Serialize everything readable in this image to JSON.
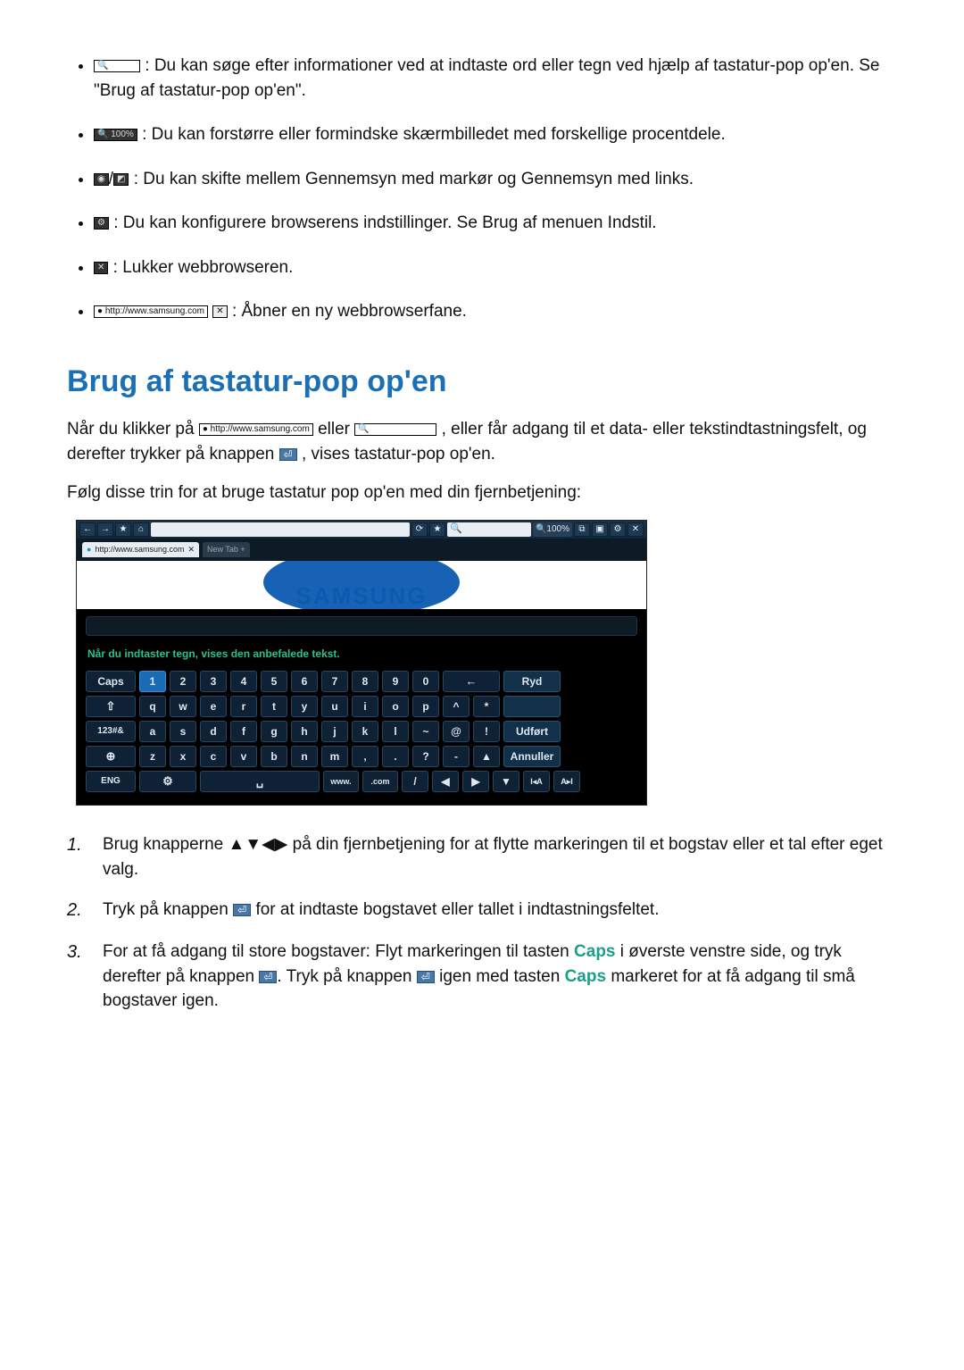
{
  "bullets": {
    "search": ": Du kan søge efter informationer ved at indtaste ord eller tegn ved hjælp af tastatur-pop op'en. Se \"Brug af tastatur-pop op'en\".",
    "zoom": ": Du kan forstørre eller formindske skærmbilledet med forskellige procentdele.",
    "cursor": ": Du kan skifte mellem Gennemsyn med markør og Gennemsyn med links.",
    "settings": ": Du kan konfigurere browserens indstillinger. Se Brug af menuen Indstil.",
    "close": ": Lukker webbrowseren.",
    "newtab": ": Åbner en ny webbrowserfane."
  },
  "zoom_chip": "100%",
  "url_chip": "http://www.samsung.com",
  "heading": "Brug af tastatur-pop op'en",
  "intro": {
    "pre": "Når du klikker på ",
    "mid": " eller ",
    "post": ", eller får adgang til et data- eller tekstindtastningsfelt, og derefter trykker på knappen ",
    "tail": ", vises tastatur-pop op'en."
  },
  "follow": "Følg disse trin for at bruge tastatur pop op'en med din fjernbetjening:",
  "mock": {
    "toolbar_zoom": "100%",
    "tab_url": "http://www.samsung.com",
    "tab_new": "New Tab +",
    "brand": "SAMSUNG",
    "hint": "Når du indtaster tegn, vises den anbefalede tekst.",
    "rows": {
      "r1_left": "Caps",
      "r1": [
        "1",
        "2",
        "3",
        "4",
        "5",
        "6",
        "7",
        "8",
        "9",
        "0"
      ],
      "r1_bksp": "←",
      "r1_action": "Ryd",
      "r2_left": "⇧",
      "r2": [
        "q",
        "w",
        "e",
        "r",
        "t",
        "y",
        "u",
        "i",
        "o",
        "p",
        "^",
        "*"
      ],
      "r3_left": "123#&",
      "r3": [
        "a",
        "s",
        "d",
        "f",
        "g",
        "h",
        "j",
        "k",
        "l",
        "~",
        "@",
        "!"
      ],
      "r3_action": "Udført",
      "r4_left": "⊕",
      "r4": [
        "z",
        "x",
        "c",
        "v",
        "b",
        "n",
        "m",
        ",",
        ".",
        "?",
        "-",
        "▲"
      ],
      "r4_action": "Annuller",
      "r5_left": "ENG",
      "r5_gear": "⚙",
      "r5_space": "␣",
      "r5_www": "www.",
      "r5_com": ".com",
      "r5_slash": "/",
      "r5_left_arrow": "◀",
      "r5_right_arrow": "▶",
      "r5_down": "▼",
      "r5_a1": "I◂A",
      "r5_a2": "A▸I"
    }
  },
  "steps": {
    "s1": {
      "pre": "Brug knapperne ",
      "arrows": "▲▼◀▶",
      "post": " på din fjernbetjening for at flytte markeringen til et bogstav eller et tal efter eget valg."
    },
    "s2": {
      "pre": "Tryk på knappen ",
      "post": " for at indtaste bogstavet eller tallet i indtastningsfeltet."
    },
    "s3": {
      "a": "For at få adgang til store bogstaver: Flyt markeringen til tasten ",
      "caps": "Caps",
      "b": " i øverste venstre side, og tryk derefter på knappen ",
      "c": ". Tryk på knappen ",
      "d": " igen med tasten ",
      "e": " markeret for at få adgang til små bogstaver igen."
    }
  }
}
